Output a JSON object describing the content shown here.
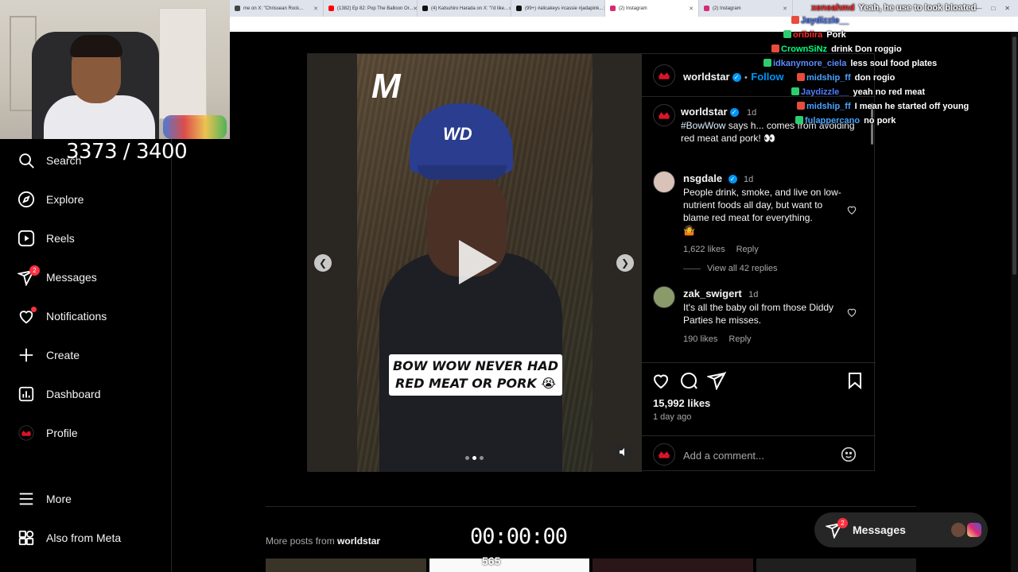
{
  "browser": {
    "tabs": [
      {
        "label": "me on X: \"Chrissean Rock...",
        "color": "#444444"
      },
      {
        "label": "(1382) Ep 82: Pop The Balloon Or...",
        "color": "#ff0000"
      },
      {
        "label": "(4) Katsuhiro Harada on X: \"I'd like...",
        "color": "#111111"
      },
      {
        "label": "(99+) #alicakeys #cassie #jadapink...",
        "color": "#111111"
      },
      {
        "label": "(2) Instagram",
        "color": "#d62976"
      },
      {
        "label": "(2) Instagram",
        "color": "#d62976"
      }
    ]
  },
  "overlay": {
    "counter": "3373 / 3400",
    "timer": "00:00:00",
    "bits_count": "565"
  },
  "sidebar": {
    "items": [
      {
        "label": "Search",
        "icon": "search-icon"
      },
      {
        "label": "Explore",
        "icon": "compass-icon"
      },
      {
        "label": "Reels",
        "icon": "reels-icon"
      },
      {
        "label": "Messages",
        "icon": "messenger-icon",
        "badge": "2"
      },
      {
        "label": "Notifications",
        "icon": "heart-icon"
      },
      {
        "label": "Create",
        "icon": "plus-icon"
      },
      {
        "label": "Dashboard",
        "icon": "dashboard-icon"
      },
      {
        "label": "Profile",
        "icon": "avatar-icon"
      },
      {
        "label": "More",
        "icon": "menu-icon"
      },
      {
        "label": "Also from Meta",
        "icon": "meta-grid-icon"
      }
    ]
  },
  "post": {
    "media_caption": "BOW WOW NEVER HAD RED MEAT OR PORK 😭",
    "cap_text": "WD",
    "logo_text": "M",
    "author": "worldstar",
    "follow_label": "Follow",
    "dot_sep": "•",
    "caption_author": "worldstar",
    "caption_time": "1d",
    "caption_hashtag": "#BowWow",
    "caption_text": " says h... comes from avoiding red meat and pork!",
    "caption_emoji": "👀",
    "comments": [
      {
        "user": "nsgdale",
        "time": "1d",
        "text": "People drink, smoke, and live on low-nutrient foods all day, but want to blame red meat for everything.",
        "emoji": "🤷",
        "likes": "1,622 likes",
        "reply": "Reply",
        "view_replies": "View all 42 replies"
      },
      {
        "user": "zak_swigert",
        "time": "1d",
        "text": "It's all the baby oil from those Diddy Parties he misses.",
        "likes": "190 likes",
        "reply": "Reply"
      }
    ],
    "likes": "15,992 likes",
    "ago": "1 day ago",
    "add_comment_placeholder": "Add a comment..."
  },
  "chat": {
    "top_user": "xeneahmd",
    "top_message": "Yeah, he use to look bloated",
    "lines": [
      {
        "user": "Jaydizzle__",
        "message": "",
        "color": "#4f7cff"
      },
      {
        "user": "oribiira",
        "message": "Pork",
        "color": "#ff2b2b"
      },
      {
        "user": "CrownSiNz",
        "message": "drink Don roggio",
        "color": "#00ff7f"
      },
      {
        "user": "idkanymore_ciela",
        "message": "less soul food plates",
        "color": "#5b8cff"
      },
      {
        "user": "midship_ff",
        "message": "don rogio",
        "color": "#4aa3ff"
      },
      {
        "user": "Jaydizzle__",
        "message": "yeah no red meat",
        "color": "#4f7cff"
      },
      {
        "user": "midship_ff",
        "message": "I mean he started off young",
        "color": "#4aa3ff"
      },
      {
        "user": "fulappercano",
        "message": "no pork",
        "color": "#4aa3ff"
      }
    ]
  },
  "bottom": {
    "more_posts_prefix": "More posts from ",
    "more_posts_user": "worldstar",
    "messages_label": "Messages",
    "messages_badge": "2"
  }
}
